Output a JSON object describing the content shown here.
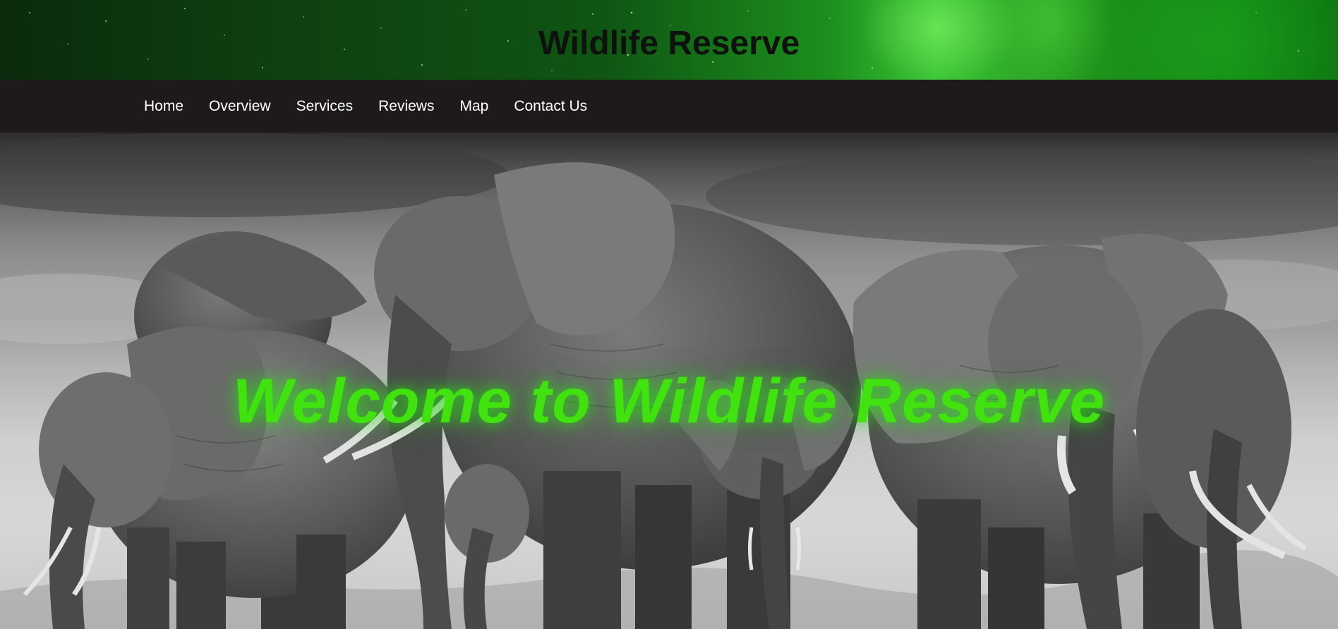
{
  "header": {
    "title": "Wildlife Reserve",
    "background_accent": "#1c8f1d"
  },
  "nav": {
    "items": [
      {
        "label": "Home"
      },
      {
        "label": "Overview"
      },
      {
        "label": "Services"
      },
      {
        "label": "Reviews"
      },
      {
        "label": "Map"
      },
      {
        "label": "Contact Us"
      }
    ],
    "background": "#1e1a1b",
    "text_color": "#ffffff"
  },
  "hero": {
    "heading": "Welcome to Wildlife Reserve",
    "heading_color": "#41e20f",
    "image_subject": "herd-of-elephants-grayscale"
  }
}
